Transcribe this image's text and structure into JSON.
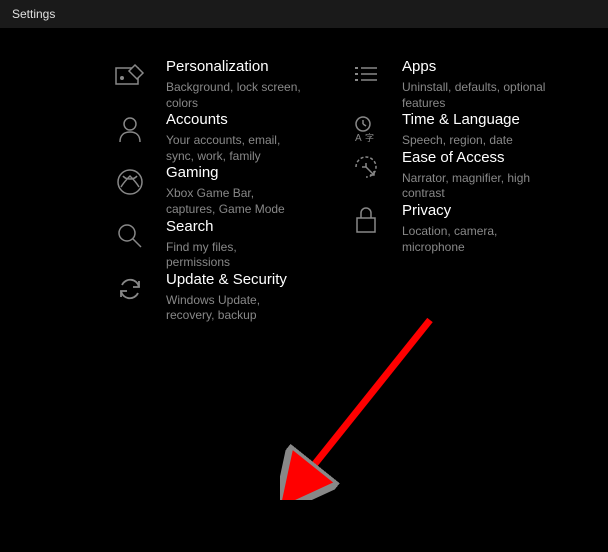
{
  "window": {
    "title": "Settings"
  },
  "tiles": {
    "personalization": {
      "title": "Personalization",
      "desc": "Background, lock screen, colors"
    },
    "apps": {
      "title": "Apps",
      "desc": "Uninstall, defaults, optional features"
    },
    "accounts": {
      "title": "Accounts",
      "desc": "Your accounts, email, sync, work, family"
    },
    "time_language": {
      "title": "Time & Language",
      "desc": "Speech, region, date"
    },
    "gaming": {
      "title": "Gaming",
      "desc": "Xbox Game Bar, captures, Game Mode"
    },
    "ease_of_access": {
      "title": "Ease of Access",
      "desc": "Narrator, magnifier, high contrast"
    },
    "search": {
      "title": "Search",
      "desc": "Find my files, permissions"
    },
    "privacy": {
      "title": "Privacy",
      "desc": "Location, camera, microphone"
    },
    "update_security": {
      "title": "Update & Security",
      "desc": "Windows Update, recovery, backup"
    }
  }
}
